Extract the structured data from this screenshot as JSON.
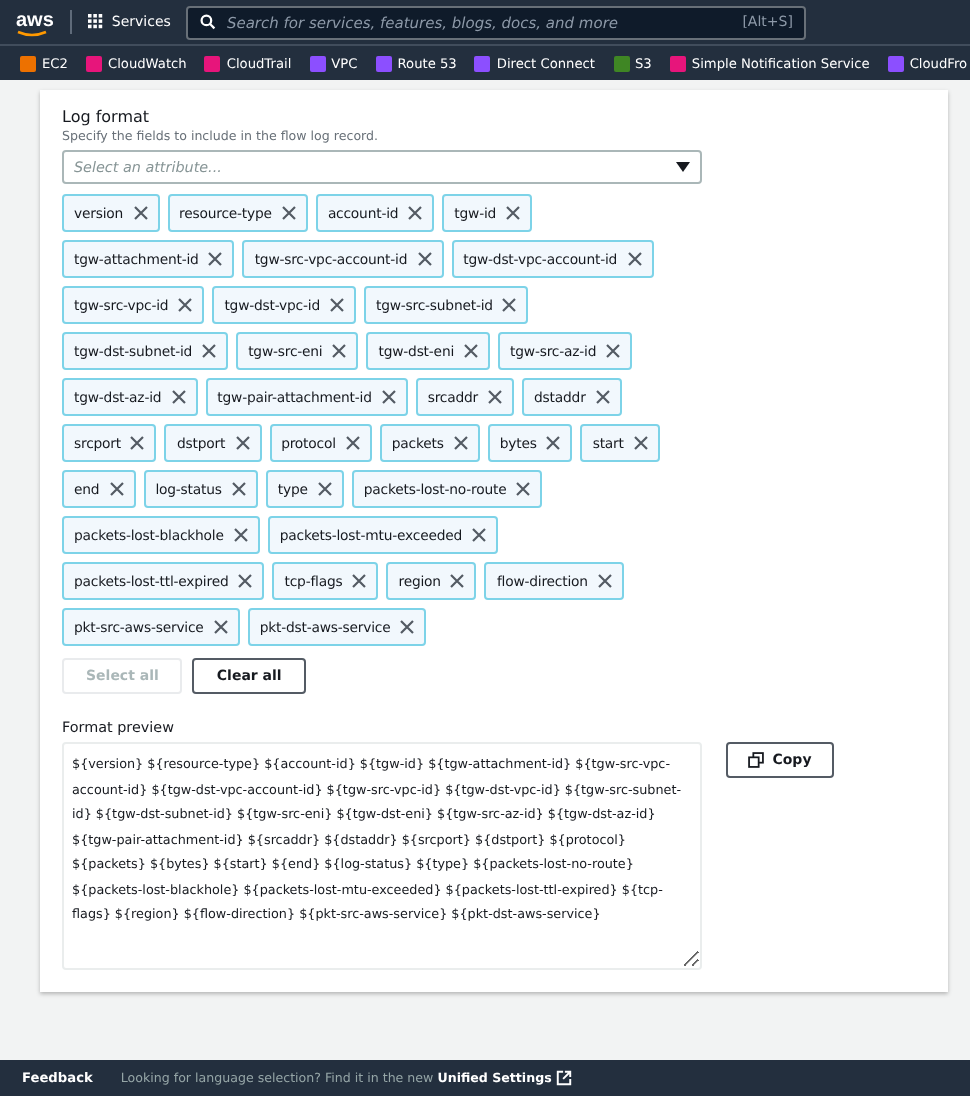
{
  "top_nav": {
    "logo": "aws",
    "services_label": "Services",
    "search": {
      "placeholder": "Search for services, features, blogs, docs, and more",
      "shortcut": "[Alt+S]"
    }
  },
  "favorites": [
    {
      "label": "EC2",
      "color": "#ed7100"
    },
    {
      "label": "CloudWatch",
      "color": "#e7157b"
    },
    {
      "label": "CloudTrail",
      "color": "#e7157b"
    },
    {
      "label": "VPC",
      "color": "#8c4fff"
    },
    {
      "label": "Route 53",
      "color": "#8c4fff"
    },
    {
      "label": "Direct Connect",
      "color": "#8c4fff"
    },
    {
      "label": "S3",
      "color": "#3f8624"
    },
    {
      "label": "Simple Notification Service",
      "color": "#e7157b"
    },
    {
      "label": "CloudFro",
      "color": "#8c4fff"
    }
  ],
  "log_format": {
    "label": "Log format",
    "hint": "Specify the fields to include in the flow log record.",
    "select": {
      "placeholder": "Select an attribute..."
    },
    "attributes": [
      "version",
      "resource-type",
      "account-id",
      "tgw-id",
      "tgw-attachment-id",
      "tgw-src-vpc-account-id",
      "tgw-dst-vpc-account-id",
      "tgw-src-vpc-id",
      "tgw-dst-vpc-id",
      "tgw-src-subnet-id",
      "tgw-dst-subnet-id",
      "tgw-src-eni",
      "tgw-dst-eni",
      "tgw-src-az-id",
      "tgw-dst-az-id",
      "tgw-pair-attachment-id",
      "srcaddr",
      "dstaddr",
      "srcport",
      "dstport",
      "protocol",
      "packets",
      "bytes",
      "start",
      "end",
      "log-status",
      "type",
      "packets-lost-no-route",
      "packets-lost-blackhole",
      "packets-lost-mtu-exceeded",
      "packets-lost-ttl-expired",
      "tcp-flags",
      "region",
      "flow-direction",
      "pkt-src-aws-service",
      "pkt-dst-aws-service"
    ],
    "buttons": [
      {
        "label": "Select all",
        "disabled": true
      },
      {
        "label": "Clear all",
        "disabled": false
      }
    ]
  },
  "format_preview": {
    "label": "Format preview",
    "value": "${version} ${resource-type} ${account-id} ${tgw-id} ${tgw-attachment-id} ${tgw-src-vpc-account-id} ${tgw-dst-vpc-account-id} ${tgw-src-vpc-id} ${tgw-dst-vpc-id} ${tgw-src-subnet-id} ${tgw-dst-subnet-id} ${tgw-src-eni} ${tgw-dst-eni} ${tgw-src-az-id} ${tgw-dst-az-id} ${tgw-pair-attachment-id} ${srcaddr} ${dstaddr} ${srcport} ${dstport} ${protocol} ${packets} ${bytes} ${start} ${end} ${log-status} ${type} ${packets-lost-no-route} ${packets-lost-blackhole} ${packets-lost-mtu-exceeded} ${packets-lost-ttl-expired} ${tcp-flags} ${region} ${flow-direction} ${pkt-src-aws-service} ${pkt-dst-aws-service}",
    "copy_button": "Copy"
  },
  "footer": {
    "feedback": "Feedback",
    "message": "Looking for language selection? Find it in the new **Unified Settings**"
  }
}
